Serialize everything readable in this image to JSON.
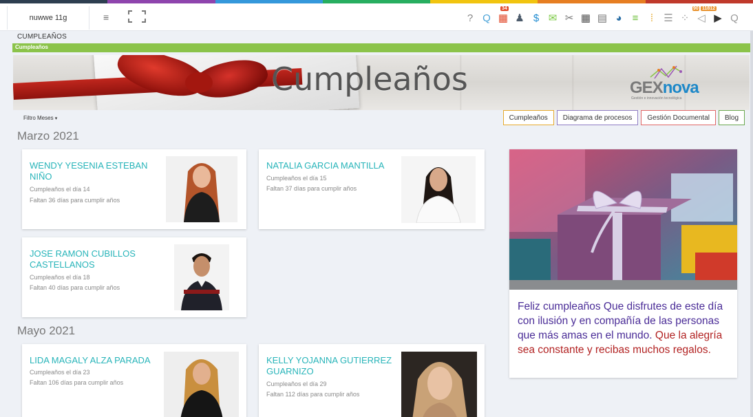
{
  "topbar": {
    "company_name": "nuwwe 11g",
    "stripe_colors": [
      "#2d3e50",
      "#8e44ad",
      "#3498db",
      "#27ae60",
      "#f1c40f",
      "#e67e22",
      "#c0392b"
    ],
    "tools": [
      {
        "icon": "help-icon",
        "glyph": "?",
        "color": "#888"
      },
      {
        "icon": "search-user-icon",
        "glyph": "Q",
        "color": "#4aa3d8"
      },
      {
        "icon": "calendar-icon",
        "glyph": "▦",
        "color": "#e24a2c",
        "badge": "34"
      },
      {
        "icon": "person-icon",
        "glyph": "♟",
        "color": "#4c5b6b"
      },
      {
        "icon": "dollar-icon",
        "glyph": "$",
        "color": "#1f8bd0"
      },
      {
        "icon": "mail-icon",
        "glyph": "✉",
        "color": "#7ac943"
      },
      {
        "icon": "tools-icon",
        "glyph": "✂",
        "color": "#777"
      },
      {
        "icon": "calculator-icon",
        "glyph": "▦",
        "color": "#555"
      },
      {
        "icon": "clipboard-icon",
        "glyph": "▤",
        "color": "#777"
      },
      {
        "icon": "dashboard-icon",
        "glyph": "◕",
        "color": "#2b6fa6"
      },
      {
        "icon": "database-icon",
        "glyph": "≡",
        "color": "#6cbf3a"
      },
      {
        "icon": "grid-apps-icon",
        "glyph": "⁞",
        "color": "#e6a92c"
      },
      {
        "icon": "list-icon",
        "glyph": "☰",
        "color": "#999"
      },
      {
        "icon": "apps-icon",
        "glyph": "⁘",
        "color": "#999"
      },
      {
        "icon": "megaphone-icon",
        "glyph": "◁",
        "color": "#999",
        "badge": "90",
        "badge2": "11812"
      },
      {
        "icon": "play-box-icon",
        "glyph": "▶",
        "color": "#333"
      },
      {
        "icon": "search-icon",
        "glyph": "Q",
        "color": "#999"
      }
    ]
  },
  "breadcrumb": {
    "title": "CUMPLEAÑOS",
    "bar_label": "Cumpleaños"
  },
  "banner": {
    "title": "Cumpleaños",
    "logo_word_1": "GEX",
    "logo_word_2": "nova",
    "logo_tagline": "Gestión e innovación tecnológica"
  },
  "filter": {
    "label": "Filtro Meses",
    "caret": "▾"
  },
  "links": [
    {
      "label": "Cumpleaños",
      "color": "#e6a92c"
    },
    {
      "label": "Diagrama de procesos",
      "color": "#8e7cc3"
    },
    {
      "label": "Gestión Documental",
      "color": "#e06666"
    },
    {
      "label": "Blog",
      "color": "#6aa84f"
    }
  ],
  "months": [
    {
      "label": "Marzo 2021",
      "people": [
        {
          "name": "WENDY YESENIA ESTEBAN NIÑO",
          "birthday": "Cumpleaños el día 14",
          "remaining": "Faltan 36 días para cumplir años"
        },
        {
          "name": "NATALIA GARCIA MANTILLA",
          "birthday": "Cumpleaños el día 15",
          "remaining": "Faltan 37 días para cumplir años"
        },
        {
          "name": "JOSE RAMON CUBILLOS CASTELLANOS",
          "birthday": "Cumpleaños el día 18",
          "remaining": "Faltan 40 días para cumplir años"
        }
      ]
    },
    {
      "label": "Mayo 2021",
      "people": [
        {
          "name": "LIDA MAGALY ALZA PARADA",
          "birthday": "Cumpleaños el día 23",
          "remaining": "Faltan 106 días para cumplir años"
        },
        {
          "name": "KELLY YOJANNA GUTIERREZ GUARNIZO",
          "birthday": "Cumpleaños el día 29",
          "remaining": "Faltan 112 días para cumplir años"
        }
      ]
    }
  ],
  "feature": {
    "message_part1": "Feliz cumpleaños Que disfrutes de este día con ilusión y en compañía de las personas que más amas en el mundo.",
    "message_part2": " Que la alegría sea constante y recibas muchos regalos."
  }
}
